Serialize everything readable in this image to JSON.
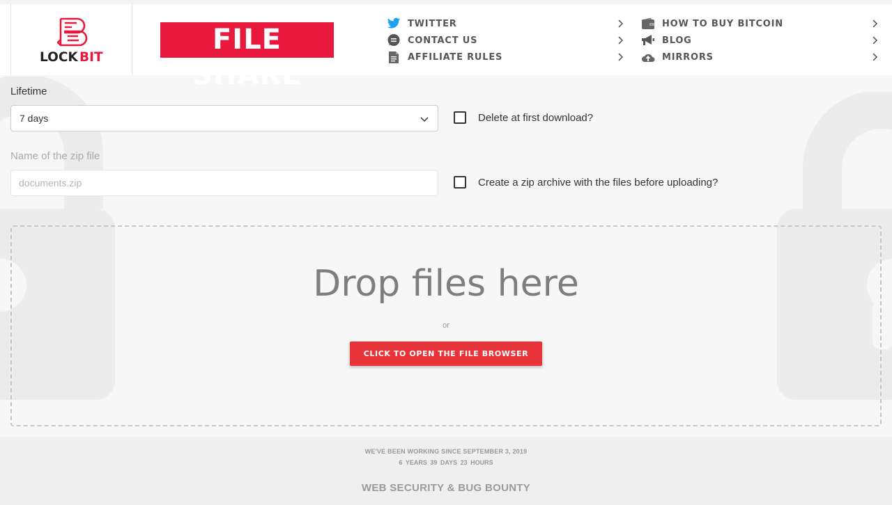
{
  "brand": {
    "logo_text": "LOCKBIT",
    "logo_text_primary": "LOCK",
    "logo_text_accent": "BIT",
    "page_title": "FILE SHARE",
    "accent_color": "#e8193c"
  },
  "nav": {
    "left": [
      {
        "label": "TWITTER",
        "icon": "twitter-icon"
      },
      {
        "label": "CONTACT US",
        "icon": "chat-icon"
      },
      {
        "label": "AFFILIATE RULES",
        "icon": "document-icon"
      }
    ],
    "right": [
      {
        "label": "HOW TO BUY BITCOIN",
        "icon": "wallet-icon"
      },
      {
        "label": "BLOG",
        "icon": "megaphone-icon"
      },
      {
        "label": "MIRRORS",
        "icon": "cloud-upload-icon"
      }
    ]
  },
  "form": {
    "lifetime_label": "Lifetime",
    "lifetime_value": "7 days",
    "lifetime_options": [
      "7 days"
    ],
    "zipname_label": "Name of the zip file",
    "zipname_placeholder": "documents.zip",
    "zipname_value": "",
    "delete_first_label": "Delete at first download?",
    "delete_first_checked": false,
    "create_zip_label": "Create a zip archive with the files before uploading?",
    "create_zip_checked": false
  },
  "dropzone": {
    "title": "Drop files here",
    "or_text": "or",
    "button_label": "CLICK TO OPEN THE FILE BROWSER"
  },
  "footer": {
    "since_text": "WE'VE BEEN WORKING SINCE SEPTEMBER 3, 2019",
    "years": "6",
    "years_unit": "YEARS",
    "days": "39",
    "days_unit": "DAYS",
    "hours": "23",
    "hours_unit": "HOURS",
    "bounty_text": "WEB SECURITY & BUG BOUNTY"
  }
}
